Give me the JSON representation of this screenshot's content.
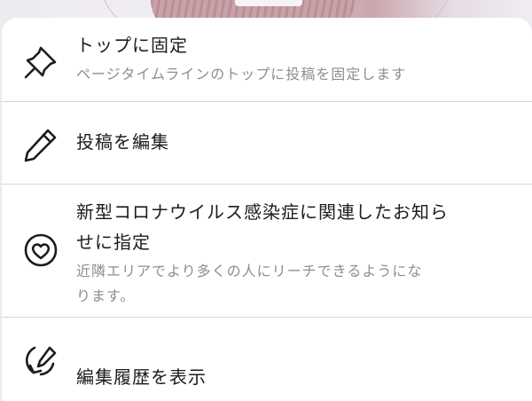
{
  "menu": {
    "items": [
      {
        "title": "トップに固定",
        "subtitle": "ページタイムラインのトップに投稿を固定します",
        "icon": "pin-icon"
      },
      {
        "title": "投稿を編集",
        "icon": "pencil-icon"
      },
      {
        "title_line1": "新型コロナウイルス感染症に関連したお知ら",
        "title_line2": "せに指定",
        "subtitle_line1": "近隣エリアでより多くの人にリーチできるようにな",
        "subtitle_line2": "ります。",
        "icon": "heart-circle-icon"
      },
      {
        "title": "編集履歴を表示",
        "icon": "edit-history-icon"
      }
    ]
  },
  "colors": {
    "title_text": "#1c1c1e",
    "subtitle_text": "#8e8e93",
    "divider": "#d7d7d9",
    "sheet_background": "#ffffff"
  }
}
